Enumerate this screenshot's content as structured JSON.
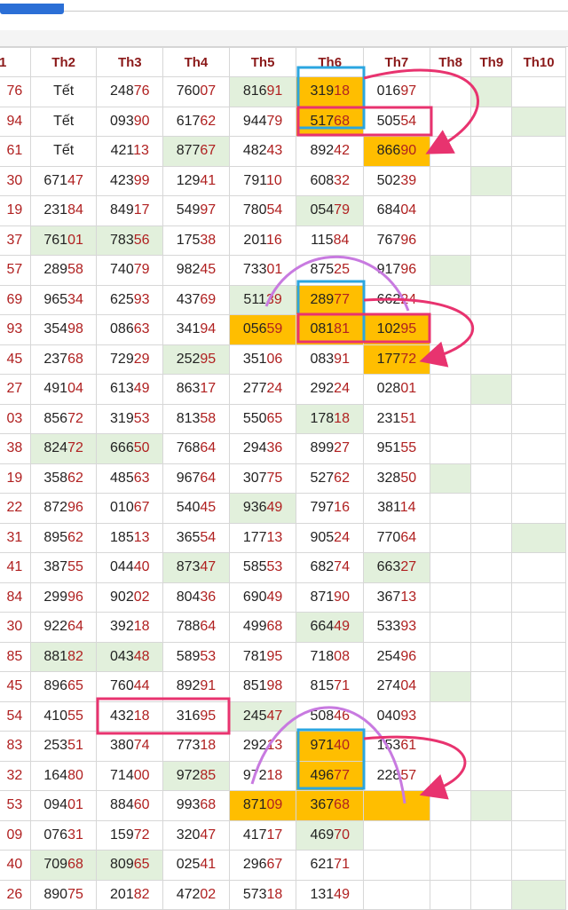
{
  "headers": [
    "1",
    "Th2",
    "Th3",
    "Th4",
    "Th5",
    "Th6",
    "Th7",
    "Th8",
    "Th9",
    "Th10"
  ],
  "rows": [
    [
      "76",
      "Tết",
      "24876",
      "76007",
      "81691",
      "31918",
      "01697",
      "",
      "",
      ""
    ],
    [
      "94",
      "Tết",
      "09390",
      "61762",
      "94479",
      "51768",
      "50554",
      "",
      "",
      ""
    ],
    [
      "61",
      "Tết",
      "42113",
      "87767",
      "48243",
      "89242",
      "86690",
      "",
      "",
      ""
    ],
    [
      "30",
      "67147",
      "42399",
      "12941",
      "79110",
      "60832",
      "50239",
      "",
      "",
      ""
    ],
    [
      "19",
      "23184",
      "84917",
      "54997",
      "78054",
      "05479",
      "68404",
      "",
      "",
      ""
    ],
    [
      "37",
      "76101",
      "78356",
      "17538",
      "20116",
      "11584",
      "76796",
      "",
      "",
      ""
    ],
    [
      "57",
      "28958",
      "74079",
      "98245",
      "73301",
      "87525",
      "91796",
      "",
      "",
      ""
    ],
    [
      "69",
      "96534",
      "62593",
      "43769",
      "51139",
      "28977",
      "66224",
      "",
      "",
      ""
    ],
    [
      "93",
      "35498",
      "08663",
      "34194",
      "05659",
      "08181",
      "10295",
      "",
      "",
      ""
    ],
    [
      "45",
      "23768",
      "72929",
      "25295",
      "35106",
      "08391",
      "17772",
      "",
      "",
      ""
    ],
    [
      "27",
      "49104",
      "61349",
      "86317",
      "27724",
      "29224",
      "02801",
      "",
      "",
      ""
    ],
    [
      "03",
      "85672",
      "31953",
      "81358",
      "55065",
      "17818",
      "23151",
      "",
      "",
      ""
    ],
    [
      "38",
      "82472",
      "66650",
      "76864",
      "29436",
      "89927",
      "95155",
      "",
      "",
      ""
    ],
    [
      "19",
      "35862",
      "48563",
      "96764",
      "30775",
      "52762",
      "32850",
      "",
      "",
      ""
    ],
    [
      "22",
      "87296",
      "01067",
      "54045",
      "93649",
      "79716",
      "38114",
      "",
      "",
      ""
    ],
    [
      "31",
      "89562",
      "18513",
      "36554",
      "17713",
      "90524",
      "77064",
      "",
      "",
      ""
    ],
    [
      "41",
      "38755",
      "04440",
      "87347",
      "58553",
      "68274",
      "66327",
      "",
      "",
      ""
    ],
    [
      "84",
      "29996",
      "90202",
      "80436",
      "69049",
      "87190",
      "36713",
      "",
      "",
      ""
    ],
    [
      "30",
      "92264",
      "39218",
      "78864",
      "49968",
      "66449",
      "53393",
      "",
      "",
      ""
    ],
    [
      "85",
      "88182",
      "04348",
      "58953",
      "78195",
      "71808",
      "25496",
      "",
      "",
      ""
    ],
    [
      "45",
      "89665",
      "76044",
      "89291",
      "85198",
      "81571",
      "27404",
      "",
      "",
      ""
    ],
    [
      "54",
      "41055",
      "43218",
      "31695",
      "24547",
      "50846",
      "04093",
      "",
      "",
      ""
    ],
    [
      "83",
      "25351",
      "38074",
      "77318",
      "29213",
      "97140",
      "15361",
      "",
      "",
      ""
    ],
    [
      "32",
      "16480",
      "71400",
      "97285",
      "97218",
      "49677",
      "22857",
      "",
      "",
      ""
    ],
    [
      "53",
      "09401",
      "88460",
      "99368",
      "87109",
      "36768",
      "",
      "",
      "",
      ""
    ],
    [
      "09",
      "07631",
      "15972",
      "32047",
      "41717",
      "46970",
      "",
      "",
      "",
      ""
    ],
    [
      "40",
      "70968",
      "80965",
      "02541",
      "29667",
      "62171",
      "",
      "",
      "",
      ""
    ],
    [
      "26",
      "89075",
      "20182",
      "47202",
      "57318",
      "13149",
      "",
      "",
      "",
      ""
    ]
  ],
  "highlight_cells": [
    [
      0,
      4,
      "g"
    ],
    [
      0,
      5,
      "o"
    ],
    [
      0,
      8,
      "g"
    ],
    [
      1,
      5,
      "o"
    ],
    [
      1,
      9,
      "g"
    ],
    [
      2,
      3,
      "g"
    ],
    [
      2,
      6,
      "o"
    ],
    [
      3,
      8,
      "g"
    ],
    [
      4,
      5,
      "g"
    ],
    [
      5,
      1,
      "g"
    ],
    [
      5,
      2,
      "g"
    ],
    [
      6,
      7,
      "g"
    ],
    [
      7,
      4,
      "g"
    ],
    [
      7,
      5,
      "o"
    ],
    [
      8,
      4,
      "o"
    ],
    [
      8,
      5,
      "o"
    ],
    [
      8,
      6,
      "o"
    ],
    [
      9,
      3,
      "g"
    ],
    [
      9,
      6,
      "o"
    ],
    [
      10,
      8,
      "g"
    ],
    [
      11,
      5,
      "g"
    ],
    [
      12,
      1,
      "g"
    ],
    [
      12,
      2,
      "g"
    ],
    [
      13,
      7,
      "g"
    ],
    [
      14,
      4,
      "g"
    ],
    [
      15,
      9,
      "g"
    ],
    [
      16,
      3,
      "g"
    ],
    [
      16,
      6,
      "g"
    ],
    [
      18,
      5,
      "g"
    ],
    [
      19,
      1,
      "g"
    ],
    [
      19,
      2,
      "g"
    ],
    [
      20,
      7,
      "g"
    ],
    [
      21,
      4,
      "g"
    ],
    [
      22,
      5,
      "o"
    ],
    [
      23,
      3,
      "g"
    ],
    [
      23,
      5,
      "o"
    ],
    [
      24,
      4,
      "o"
    ],
    [
      24,
      5,
      "o"
    ],
    [
      24,
      6,
      "o"
    ],
    [
      24,
      8,
      "g"
    ],
    [
      25,
      5,
      "g"
    ],
    [
      26,
      1,
      "g"
    ],
    [
      26,
      2,
      "g"
    ],
    [
      27,
      9,
      "g"
    ]
  ],
  "colors": {
    "header_text": "#8b1a1a",
    "digit_dark": "#222222",
    "digit_red": "#b02020",
    "green_cell": "#e2f0dc",
    "orange_cell": "#ffbe00",
    "blue_box": "#2ba6e0",
    "pink_box": "#e8336f",
    "purple_arc": "#c87ae0"
  }
}
